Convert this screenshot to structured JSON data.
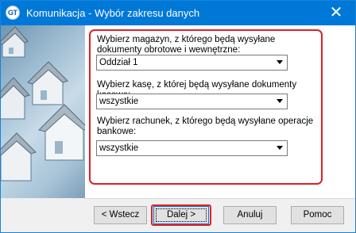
{
  "window": {
    "title": "Komunikacja - Wybór zakresu danych",
    "app_icon_text": "GT",
    "close_glyph": "✕"
  },
  "form": {
    "warehouse_label": "Wybierz magazyn, z którego będą wysyłane dokumenty obrotowe i wewnętrzne:",
    "warehouse_value": "Oddział 1",
    "cashbox_label": "Wybierz kasę, z której będą wysyłane dokumenty kasowe:",
    "cashbox_value": "wszystkie",
    "account_label": "Wybierz rachunek, z którego będą wysyłane operacje bankowe:",
    "account_value": "wszystkie"
  },
  "buttons": {
    "back": "< Wstecz",
    "next": "Dalej >",
    "cancel": "Anuluj",
    "help": "Pomoc"
  },
  "colors": {
    "titlebar": "#0078d7",
    "highlight": "#e01f26"
  }
}
